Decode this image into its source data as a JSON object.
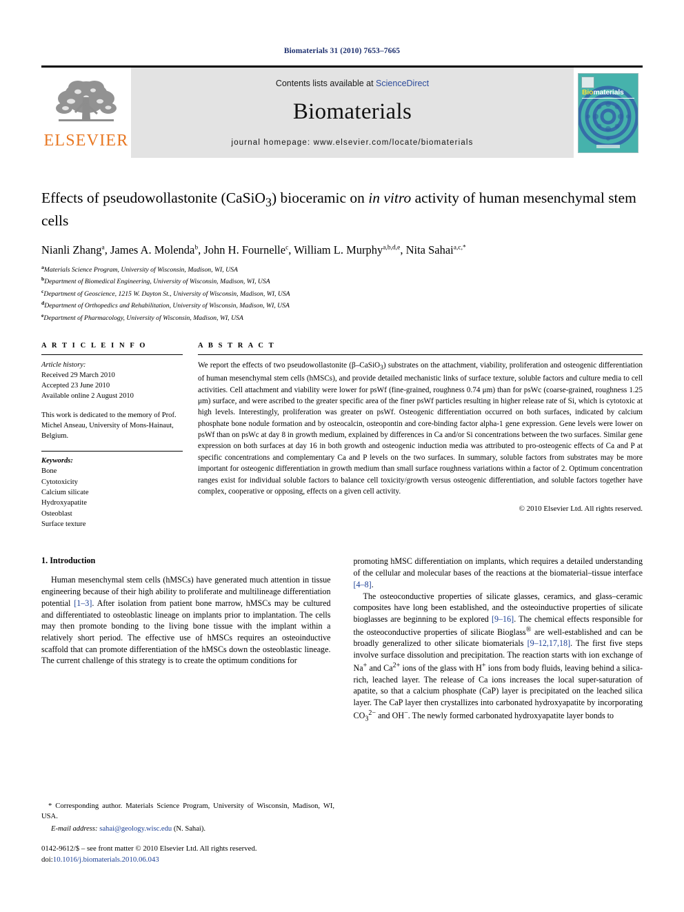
{
  "running_head": "Biomaterials 31 (2010) 7653–7665",
  "masthead": {
    "publisher_logo_name": "elsevier-tree-logo",
    "publisher_wordmark": "ELSEVIER",
    "contents_prefix": "Contents lists available at ",
    "contents_link": "ScienceDirect",
    "journal_name": "Biomaterials",
    "homepage": "journal homepage: www.elsevier.com/locate/biomaterials",
    "cover": {
      "title_part1": "Bio",
      "title_part2": "materials"
    }
  },
  "article": {
    "title_line1_pre": "Effects of pseudowollastonite (CaSiO",
    "title_sub": "3",
    "title_line1_mid": ") bioceramic on ",
    "title_italic": "in vitro",
    "title_line1_post": " activity of human",
    "title_line2": "mesenchymal stem cells",
    "authors": [
      {
        "name": "Nianli Zhang",
        "sup": "a",
        "sep": ", "
      },
      {
        "name": "James A. Molenda",
        "sup": "b",
        "sep": ", "
      },
      {
        "name": "John H. Fournelle",
        "sup": "c",
        "sep": ", "
      },
      {
        "name": "William L. Murphy",
        "sup": "a,b,d,e",
        "sep": ", "
      },
      {
        "name": "Nita Sahai",
        "sup": "a,c,",
        "sep": ""
      }
    ],
    "corresponding_marker": "*",
    "affiliations": [
      {
        "label": "a",
        "text": "Materials Science Program, University of Wisconsin, Madison, WI, USA"
      },
      {
        "label": "b",
        "text": "Department of Biomedical Engineering, University of Wisconsin, Madison, WI, USA"
      },
      {
        "label": "c",
        "text": "Department of Geoscience, 1215 W. Dayton St., University of Wisconsin, Madison, WI, USA"
      },
      {
        "label": "d",
        "text": "Department of Orthopedics and Rehabilitation, University of Wisconsin, Madison, WI, USA"
      },
      {
        "label": "e",
        "text": "Department of Pharmacology, University of Wisconsin, Madison, WI, USA"
      }
    ]
  },
  "article_info": {
    "heading": "A R T I C L E   I N F O",
    "history_label": "Article history:",
    "history": [
      "Received 29 March 2010",
      "Accepted 23 June 2010",
      "Available online 2 August 2010"
    ],
    "dedication": "This work is dedicated to the memory of Prof. Michel Anseau, University of Mons-Hainaut, Belgium.",
    "keywords_label": "Keywords:",
    "keywords": [
      "Bone",
      "Cytotoxicity",
      "Calcium silicate",
      "Hydroxyapatite",
      "Osteoblast",
      "Surface texture"
    ]
  },
  "abstract": {
    "heading": "A B S T R A C T",
    "text_part1": "We report the effects of two pseudowollastonite (β–CaSiO",
    "text_sub": "3",
    "text_part2": ") substrates on the attachment, viability, proliferation and osteogenic differentiation of human mesenchymal stem cells (hMSCs), and provide detailed mechanistic links of surface texture, soluble factors and culture media to cell activities. Cell attachment and viability were lower for psWf (fine-grained, roughness 0.74 μm) than for psWc (coarse-grained, roughness 1.25 μm) surface, and were ascribed to the greater specific area of the finer psWf particles resulting in higher release rate of Si, which is cytotoxic at high levels. Interestingly, proliferation was greater on psWf. Osteogenic differentiation occurred on both surfaces, indicated by calcium phosphate bone nodule formation and by osteocalcin, osteopontin and core-binding factor alpha-1 gene expression. Gene levels were lower on psWf than on psWc at day 8 in growth medium, explained by differences in Ca and/or Si concentrations between the two surfaces. Similar gene expression on both surfaces at day 16 in both growth and osteogenic induction media was attributed to pro-osteogenic effects of Ca and P at specific concentrations and complementary Ca and P levels on the two surfaces. In summary, soluble factors from substrates may be more important for osteogenic differentiation in growth medium than small surface roughness variations within a factor of 2. Optimum concentration ranges exist for individual soluble factors to balance cell toxicity/growth versus osteogenic differentiation, and soluble factors together have complex, cooperative or opposing, effects on a given cell activity.",
    "copyright": "© 2010 Elsevier Ltd. All rights reserved."
  },
  "introduction": {
    "number_title": "1.  Introduction",
    "left_para1_a": "Human mesenchymal stem cells (hMSCs) have generated much attention in tissue engineering because of their high ability to proliferate and multilineage differentiation potential ",
    "left_cite1": "[1–3]",
    "left_para1_b": ". After isolation from patient bone marrow, hMSCs may be cultured and differentiated to osteoblastic lineage on implants prior to implantation. The cells may then promote bonding to the living bone tissue with the implant within a relatively short period. The effective use of hMSCs requires an osteoinductive scaffold that can promote differentiation of the hMSCs down the osteoblastic lineage. The current challenge of this strategy is to create the optimum conditions for",
    "right_para1_a": "promoting hMSC differentiation on implants, which requires a detailed understanding of the cellular and molecular bases of the reactions at the biomaterial–tissue interface ",
    "right_cite1": "[4–8]",
    "right_para1_b": ".",
    "right_para2_a": "The osteoconductive properties of silicate glasses, ceramics, and glass–ceramic composites have long been established, and the osteoinductive properties of silicate bioglasses are beginning to be explored ",
    "right_cite2": "[9–16]",
    "right_para2_b": ". The chemical effects responsible for the osteoconductive properties of silicate Bioglass",
    "right_reg": "®",
    "right_para2_c": " are well-established and can be broadly generalized to other silicate biomaterials ",
    "right_cite3": "[9–12,17,18]",
    "right_para2_d": ". The first five steps involve surface dissolution and precipitation. The reaction starts with ion exchange of Na",
    "sup_na": "+",
    "right_para2_e": " and Ca",
    "sup_ca": "2+",
    "right_para2_f": " ions of the glass with H",
    "sup_h": "+",
    "right_para2_g": " ions from body fluids, leaving behind a silica-rich, leached layer. The release of Ca ions increases the local super-saturation of apatite, so that a calcium phosphate (CaP) layer is precipitated on the leached silica layer. The CaP layer then crystallizes into carbonated hydroxyapatite by incorporating CO",
    "sub_co3": "3",
    "sup_co3": "2−",
    "right_para2_h": " and OH",
    "sup_oh": "−",
    "right_para2_i": ". The newly formed carbonated hydroxyapatite layer bonds to"
  },
  "footnotes": {
    "corresponding": "* Corresponding author. Materials Science Program, University of Wisconsin, Madison, WI, USA.",
    "email_label": "E-mail address:",
    "email": "sahai@geology.wisc.edu",
    "email_suffix": " (N. Sahai).",
    "issn_line": "0142-9612/$ – see front matter © 2010 Elsevier Ltd. All rights reserved.",
    "doi_label": "doi:",
    "doi": "10.1016/j.biomaterials.2010.06.043"
  }
}
